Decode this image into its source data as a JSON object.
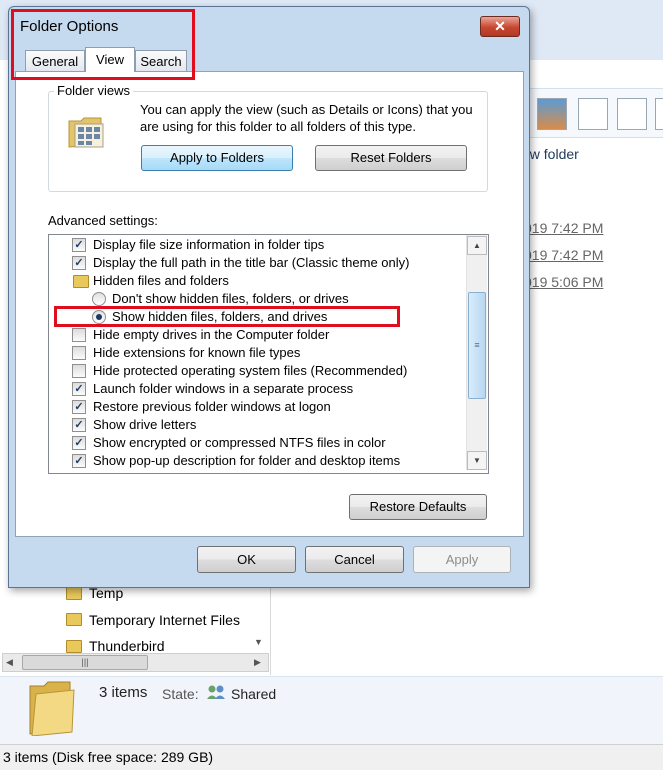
{
  "dialog": {
    "title": "Folder Options",
    "close_glyph": "✕",
    "tabs": [
      {
        "label": "General"
      },
      {
        "label": "View"
      },
      {
        "label": "Search"
      }
    ],
    "active_tab": "View",
    "folder_views": {
      "legend": "Folder views",
      "description": "You can apply the view (such as Details or Icons) that you are using for this folder to all folders of this type.",
      "apply_button": "Apply to Folders",
      "reset_button": "Reset Folders"
    },
    "advanced": {
      "label": "Advanced settings:",
      "items": [
        {
          "type": "checkbox",
          "checked": true,
          "label": "Display file size information in folder tips"
        },
        {
          "type": "checkbox",
          "checked": true,
          "label": "Display the full path in the title bar (Classic theme only)"
        },
        {
          "type": "folder",
          "label": "Hidden files and folders"
        },
        {
          "type": "radio",
          "checked": false,
          "label": "Don't show hidden files, folders, or drives"
        },
        {
          "type": "radio",
          "checked": true,
          "label": "Show hidden files, folders, and drives"
        },
        {
          "type": "checkbox",
          "checked": false,
          "label": "Hide empty drives in the Computer folder"
        },
        {
          "type": "checkbox",
          "checked": false,
          "label": "Hide extensions for known file types"
        },
        {
          "type": "checkbox",
          "checked": false,
          "label": "Hide protected operating system files (Recommended)"
        },
        {
          "type": "checkbox",
          "checked": true,
          "label": "Launch folder windows in a separate process"
        },
        {
          "type": "checkbox",
          "checked": true,
          "label": "Restore previous folder windows at logon"
        },
        {
          "type": "checkbox",
          "checked": true,
          "label": "Show drive letters"
        },
        {
          "type": "checkbox",
          "checked": true,
          "label": "Show encrypted or compressed NTFS files in color"
        },
        {
          "type": "checkbox",
          "checked": true,
          "label": "Show pop-up description for folder and desktop items"
        }
      ],
      "restore_defaults": "Restore Defaults"
    },
    "buttons": {
      "ok": "OK",
      "cancel": "Cancel",
      "apply": "Apply"
    }
  },
  "background": {
    "new_folder": "ew folder",
    "dates": [
      "019 7:42 PM",
      "019 7:42 PM",
      "019 5:06 PM"
    ],
    "tree": [
      {
        "label": "Temp"
      },
      {
        "label": "Temporary Internet Files"
      },
      {
        "label": "Thunderbird"
      }
    ],
    "details": {
      "count": "3 items",
      "state_label": "State:",
      "state_value": "Shared"
    },
    "statusbar": "3 items (Disk free space: 289 GB)"
  },
  "colors": {
    "highlight": "#e00d1e",
    "dialog_frame": "#c5d9ef",
    "accent_button": "#bee6fd"
  }
}
